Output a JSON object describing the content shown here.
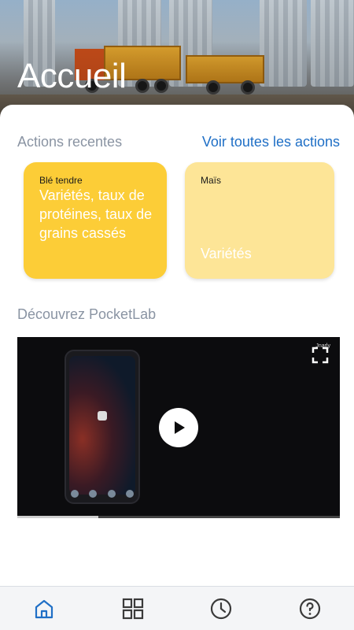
{
  "header": {
    "title": "Accueil"
  },
  "recent": {
    "title": "Actions recentes",
    "see_all": "Voir toutes les actions",
    "cards": [
      {
        "category": "Blé tendre",
        "text": "Variétés, taux de protéines, taux de grains cassés",
        "color": "#fccd37"
      },
      {
        "category": "Maïs",
        "text": "Variétés",
        "color": "#fde597"
      }
    ]
  },
  "discover": {
    "title": "Découvrez PocketLab",
    "video": {
      "brand": "Jnarly",
      "progress": 0.25
    }
  },
  "bottom_nav": {
    "items": [
      {
        "icon": "home-icon",
        "active": true
      },
      {
        "icon": "grid-icon",
        "active": false
      },
      {
        "icon": "clock-icon",
        "active": false
      },
      {
        "icon": "help-icon",
        "active": false
      }
    ],
    "active_color": "#1f6fc6",
    "inactive_color": "#3a3a3a"
  }
}
